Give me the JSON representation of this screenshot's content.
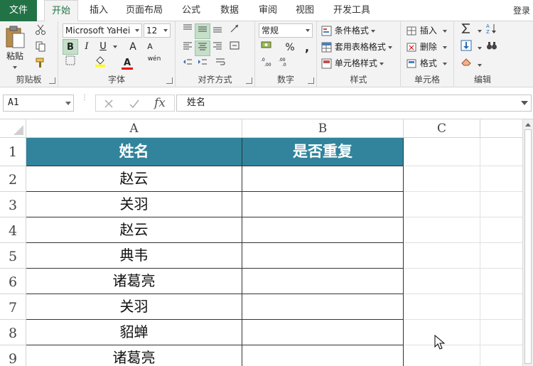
{
  "tabs": [
    {
      "label": "文件"
    },
    {
      "label": "开始"
    },
    {
      "label": "插入"
    },
    {
      "label": "页面布局"
    },
    {
      "label": "公式"
    },
    {
      "label": "数据"
    },
    {
      "label": "审阅"
    },
    {
      "label": "视图"
    },
    {
      "label": "开发工具"
    }
  ],
  "login_label": "登录",
  "ribbon": {
    "clipboard": {
      "group_label": "剪贴板",
      "paste_label": "粘贴"
    },
    "font": {
      "group_label": "字体",
      "font_name": "Microsoft YaHei",
      "font_size": "12",
      "bold": "B",
      "italic": "I",
      "underline": "U",
      "grow": "A",
      "shrink": "A",
      "font_color_letter": "A",
      "phonetic": "wén"
    },
    "alignment": {
      "group_label": "对齐方式"
    },
    "number": {
      "group_label": "数字",
      "format": "常规",
      "percent": "%",
      "comma": ","
    },
    "styles": {
      "group_label": "样式",
      "conditional": "条件格式",
      "table_format": "套用表格格式",
      "cell_styles": "单元格样式"
    },
    "cells": {
      "group_label": "单元格",
      "insert": "插入",
      "delete": "删除",
      "format": "格式"
    },
    "editing": {
      "group_label": "编辑"
    }
  },
  "formula_bar": {
    "name_box": "A1",
    "fx": "fx",
    "value": "姓名"
  },
  "columns": [
    "A",
    "B",
    "C"
  ],
  "rows": [
    1,
    2,
    3,
    4,
    5,
    6,
    7,
    8,
    9
  ],
  "table": {
    "headers": [
      "姓名",
      "是否重复"
    ],
    "names": [
      "赵云",
      "关羽",
      "赵云",
      "典韦",
      "诸葛亮",
      "关羽",
      "貂蝉",
      "诸葛亮"
    ]
  },
  "colors": {
    "accent": "#217346",
    "header_fill": "#31849b",
    "header_text": "#ffffff"
  }
}
